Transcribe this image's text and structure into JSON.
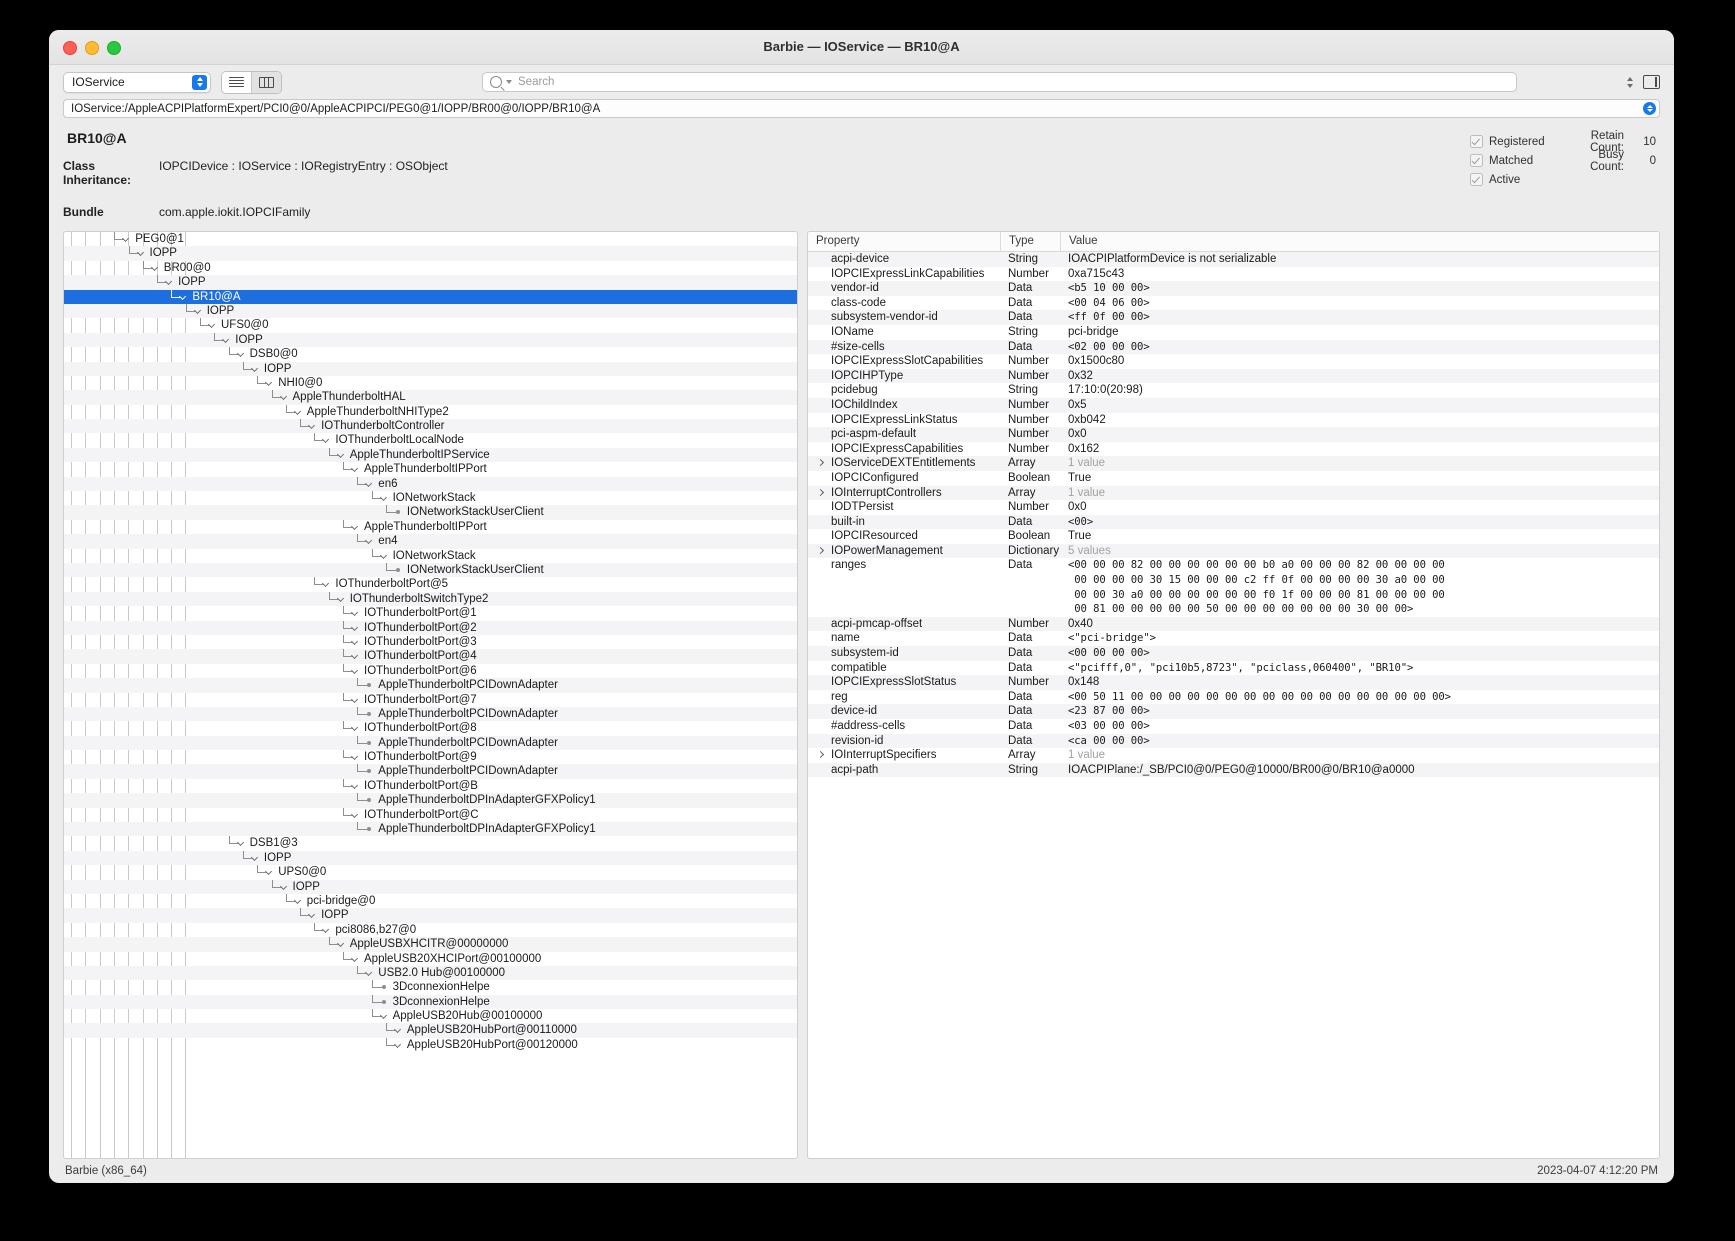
{
  "window": {
    "title": "Barbie — IOService — BR10@A"
  },
  "toolbar": {
    "plane_selector": "IOService",
    "view_list_icon": "list-view-icon",
    "view_column_icon": "column-view-icon",
    "search_placeholder": "Search",
    "search_value": "",
    "search_icon": "search-icon",
    "stepper_icon": "stepper-icon",
    "sidebar_icon": "sidebar-toggle-icon"
  },
  "path_bar": {
    "value": "IOService:/AppleACPIPlatformExpert/PCI0@0/AppleACPIPCI/PEG0@1/IOPP/BR00@0/IOPP/BR10@A"
  },
  "details": {
    "device_title": "BR10@A",
    "class_inheritance_label": "Class Inheritance:",
    "class_inheritance_value": "IOPCIDevice : IOService : IORegistryEntry : OSObject",
    "bundle_label": "Bundle",
    "bundle_value": "com.apple.iokit.IOPCIFamily",
    "flags": [
      {
        "label": "Registered",
        "checked": true,
        "count_label": "Retain Count:",
        "count_value": "10"
      },
      {
        "label": "Matched",
        "checked": true,
        "count_label": "Busy Count:",
        "count_value": "0"
      },
      {
        "label": "Active",
        "checked": true,
        "count_label": "",
        "count_value": ""
      }
    ]
  },
  "tree": {
    "nodes": [
      {
        "depth": 4,
        "label": "PEG0@1",
        "kind": "chevron",
        "selected": false
      },
      {
        "depth": 5,
        "label": "IOPP",
        "kind": "chevron",
        "selected": false
      },
      {
        "depth": 6,
        "label": "BR00@0",
        "kind": "chevron",
        "selected": false
      },
      {
        "depth": 7,
        "label": "IOPP",
        "kind": "chevron",
        "selected": false
      },
      {
        "depth": 8,
        "label": "BR10@A",
        "kind": "chevron",
        "selected": true
      },
      {
        "depth": 9,
        "label": "IOPP",
        "kind": "chevron",
        "selected": false
      },
      {
        "depth": 10,
        "label": "UFS0@0",
        "kind": "chevron",
        "selected": false
      },
      {
        "depth": 11,
        "label": "IOPP",
        "kind": "chevron",
        "selected": false
      },
      {
        "depth": 12,
        "label": "DSB0@0",
        "kind": "chevron",
        "selected": false
      },
      {
        "depth": 13,
        "label": "IOPP",
        "kind": "chevron",
        "selected": false
      },
      {
        "depth": 14,
        "label": "NHI0@0",
        "kind": "chevron",
        "selected": false
      },
      {
        "depth": 15,
        "label": "AppleThunderboltHAL",
        "kind": "chevron",
        "selected": false
      },
      {
        "depth": 16,
        "label": "AppleThunderboltNHIType2",
        "kind": "chevron",
        "selected": false
      },
      {
        "depth": 17,
        "label": "IOThunderboltController",
        "kind": "chevron",
        "selected": false
      },
      {
        "depth": 18,
        "label": "IOThunderboltLocalNode",
        "kind": "chevron",
        "selected": false
      },
      {
        "depth": 19,
        "label": "AppleThunderboltIPService",
        "kind": "chevron",
        "selected": false
      },
      {
        "depth": 20,
        "label": "AppleThunderboltIPPort",
        "kind": "chevron",
        "selected": false
      },
      {
        "depth": 21,
        "label": "en6",
        "kind": "chevron",
        "selected": false
      },
      {
        "depth": 22,
        "label": "IONetworkStack",
        "kind": "chevron",
        "selected": false
      },
      {
        "depth": 23,
        "label": "IONetworkStackUserClient",
        "kind": "dot",
        "selected": false
      },
      {
        "depth": 20,
        "label": "AppleThunderboltIPPort",
        "kind": "chevron",
        "selected": false
      },
      {
        "depth": 21,
        "label": "en4",
        "kind": "chevron",
        "selected": false
      },
      {
        "depth": 22,
        "label": "IONetworkStack",
        "kind": "chevron",
        "selected": false
      },
      {
        "depth": 23,
        "label": "IONetworkStackUserClient",
        "kind": "dot",
        "selected": false
      },
      {
        "depth": 18,
        "label": "IOThunderboltPort@5",
        "kind": "chevron",
        "selected": false
      },
      {
        "depth": 19,
        "label": "IOThunderboltSwitchType2",
        "kind": "chevron",
        "selected": false
      },
      {
        "depth": 20,
        "label": "IOThunderboltPort@1",
        "kind": "chevron",
        "selected": false
      },
      {
        "depth": 20,
        "label": "IOThunderboltPort@2",
        "kind": "chevron",
        "selected": false
      },
      {
        "depth": 20,
        "label": "IOThunderboltPort@3",
        "kind": "chevron",
        "selected": false
      },
      {
        "depth": 20,
        "label": "IOThunderboltPort@4",
        "kind": "chevron",
        "selected": false
      },
      {
        "depth": 20,
        "label": "IOThunderboltPort@6",
        "kind": "chevron",
        "selected": false
      },
      {
        "depth": 21,
        "label": "AppleThunderboltPCIDownAdapter",
        "kind": "dot",
        "selected": false
      },
      {
        "depth": 20,
        "label": "IOThunderboltPort@7",
        "kind": "chevron",
        "selected": false
      },
      {
        "depth": 21,
        "label": "AppleThunderboltPCIDownAdapter",
        "kind": "dot",
        "selected": false
      },
      {
        "depth": 20,
        "label": "IOThunderboltPort@8",
        "kind": "chevron",
        "selected": false
      },
      {
        "depth": 21,
        "label": "AppleThunderboltPCIDownAdapter",
        "kind": "dot",
        "selected": false
      },
      {
        "depth": 20,
        "label": "IOThunderboltPort@9",
        "kind": "chevron",
        "selected": false
      },
      {
        "depth": 21,
        "label": "AppleThunderboltPCIDownAdapter",
        "kind": "dot",
        "selected": false
      },
      {
        "depth": 20,
        "label": "IOThunderboltPort@B",
        "kind": "chevron",
        "selected": false
      },
      {
        "depth": 21,
        "label": "AppleThunderboltDPInAdapterGFXPolicy1",
        "kind": "dot",
        "selected": false
      },
      {
        "depth": 20,
        "label": "IOThunderboltPort@C",
        "kind": "chevron",
        "selected": false
      },
      {
        "depth": 21,
        "label": "AppleThunderboltDPInAdapterGFXPolicy1",
        "kind": "dot",
        "selected": false
      },
      {
        "depth": 12,
        "label": "DSB1@3",
        "kind": "chevron",
        "selected": false
      },
      {
        "depth": 13,
        "label": "IOPP",
        "kind": "chevron",
        "selected": false
      },
      {
        "depth": 14,
        "label": "UPS0@0",
        "kind": "chevron",
        "selected": false
      },
      {
        "depth": 15,
        "label": "IOPP",
        "kind": "chevron",
        "selected": false
      },
      {
        "depth": 16,
        "label": "pci-bridge@0",
        "kind": "chevron",
        "selected": false
      },
      {
        "depth": 17,
        "label": "IOPP",
        "kind": "chevron",
        "selected": false
      },
      {
        "depth": 18,
        "label": "pci8086,b27@0",
        "kind": "chevron",
        "selected": false
      },
      {
        "depth": 19,
        "label": "AppleUSBXHCITR@00000000",
        "kind": "chevron",
        "selected": false
      },
      {
        "depth": 20,
        "label": "AppleUSB20XHCIPort@00100000",
        "kind": "chevron",
        "selected": false
      },
      {
        "depth": 21,
        "label": "USB2.0 Hub@00100000",
        "kind": "chevron",
        "selected": false
      },
      {
        "depth": 22,
        "label": "3DconnexionHelpe",
        "kind": "dot",
        "selected": false
      },
      {
        "depth": 22,
        "label": "3DconnexionHelpe",
        "kind": "dot",
        "selected": false
      },
      {
        "depth": 22,
        "label": "AppleUSB20Hub@00100000",
        "kind": "chevron",
        "selected": false
      },
      {
        "depth": 23,
        "label": "AppleUSB20HubPort@00110000",
        "kind": "chevron",
        "selected": false
      },
      {
        "depth": 23,
        "label": "AppleUSB20HubPort@00120000",
        "kind": "chevron",
        "selected": false
      }
    ]
  },
  "properties": {
    "headers": {
      "property": "Property",
      "type": "Type",
      "value": "Value"
    },
    "rows": [
      {
        "name": "acpi-device",
        "type": "String",
        "value": "IOACPIPlatformDevice is not serializable",
        "style": "plain",
        "expandable": false
      },
      {
        "name": "IOPCIExpressLinkCapabilities",
        "type": "Number",
        "value": "0xa715c43",
        "style": "plain",
        "expandable": false
      },
      {
        "name": "vendor-id",
        "type": "Data",
        "value": "<b5 10 00 00>",
        "style": "mono",
        "expandable": false
      },
      {
        "name": "class-code",
        "type": "Data",
        "value": "<00 04 06 00>",
        "style": "mono",
        "expandable": false
      },
      {
        "name": "subsystem-vendor-id",
        "type": "Data",
        "value": "<ff 0f 00 00>",
        "style": "mono",
        "expandable": false
      },
      {
        "name": "IOName",
        "type": "String",
        "value": "pci-bridge",
        "style": "plain",
        "expandable": false
      },
      {
        "name": "#size-cells",
        "type": "Data",
        "value": "<02 00 00 00>",
        "style": "mono",
        "expandable": false
      },
      {
        "name": "IOPCIExpressSlotCapabilities",
        "type": "Number",
        "value": "0x1500c80",
        "style": "plain",
        "expandable": false
      },
      {
        "name": "IOPCIHPType",
        "type": "Number",
        "value": "0x32",
        "style": "plain",
        "expandable": false
      },
      {
        "name": "pcidebug",
        "type": "String",
        "value": "17:10:0(20:98)",
        "style": "plain",
        "expandable": false
      },
      {
        "name": "IOChildIndex",
        "type": "Number",
        "value": "0x5",
        "style": "plain",
        "expandable": false
      },
      {
        "name": "IOPCIExpressLinkStatus",
        "type": "Number",
        "value": "0xb042",
        "style": "plain",
        "expandable": false
      },
      {
        "name": "pci-aspm-default",
        "type": "Number",
        "value": "0x0",
        "style": "plain",
        "expandable": false
      },
      {
        "name": "IOPCIExpressCapabilities",
        "type": "Number",
        "value": "0x162",
        "style": "plain",
        "expandable": false
      },
      {
        "name": "IOServiceDEXTEntitlements",
        "type": "Array",
        "value": "1 value",
        "style": "dim",
        "expandable": true
      },
      {
        "name": "IOPCIConfigured",
        "type": "Boolean",
        "value": "True",
        "style": "plain",
        "expandable": false
      },
      {
        "name": "IOInterruptControllers",
        "type": "Array",
        "value": "1 value",
        "style": "dim",
        "expandable": true
      },
      {
        "name": "IODTPersist",
        "type": "Number",
        "value": "0x0",
        "style": "plain",
        "expandable": false
      },
      {
        "name": "built-in",
        "type": "Data",
        "value": "<00>",
        "style": "mono",
        "expandable": false
      },
      {
        "name": "IOPCIResourced",
        "type": "Boolean",
        "value": "True",
        "style": "plain",
        "expandable": false
      },
      {
        "name": "IOPowerManagement",
        "type": "Dictionary",
        "value": "5 values",
        "style": "dim",
        "expandable": true
      },
      {
        "name": "ranges",
        "type": "Data",
        "value": "<00 00 00 82 00 00 00 00 00 00 b0 a0 00 00 00 82 00 00 00 00\n 00 00 00 00 30 15 00 00 00 c2 ff 0f 00 00 00 00 30 a0 00 00\n 00 00 30 a0 00 00 00 00 00 00 f0 1f 00 00 00 81 00 00 00 00\n 00 81 00 00 00 00 00 50 00 00 00 00 00 00 00 30 00 00>",
        "style": "mono",
        "expandable": false
      },
      {
        "name": "acpi-pmcap-offset",
        "type": "Number",
        "value": "0x40",
        "style": "plain",
        "expandable": false
      },
      {
        "name": "name",
        "type": "Data",
        "value": "<\"pci-bridge\">",
        "style": "mono",
        "expandable": false
      },
      {
        "name": "subsystem-id",
        "type": "Data",
        "value": "<00 00 00 00>",
        "style": "mono",
        "expandable": false
      },
      {
        "name": "compatible",
        "type": "Data",
        "value": "<\"pcifff,0\", \"pci10b5,8723\", \"pciclass,060400\", \"BR10\">",
        "style": "mono",
        "expandable": false
      },
      {
        "name": "IOPCIExpressSlotStatus",
        "type": "Number",
        "value": "0x148",
        "style": "plain",
        "expandable": false
      },
      {
        "name": "reg",
        "type": "Data",
        "value": "<00 50 11 00 00 00 00 00 00 00 00 00 00 00 00 00 00 00 00 00>",
        "style": "mono",
        "expandable": false
      },
      {
        "name": "device-id",
        "type": "Data",
        "value": "<23 87 00 00>",
        "style": "mono",
        "expandable": false
      },
      {
        "name": "#address-cells",
        "type": "Data",
        "value": "<03 00 00 00>",
        "style": "mono",
        "expandable": false
      },
      {
        "name": "revision-id",
        "type": "Data",
        "value": "<ca 00 00 00>",
        "style": "mono",
        "expandable": false
      },
      {
        "name": "IOInterruptSpecifiers",
        "type": "Array",
        "value": "1 value",
        "style": "dim",
        "expandable": true
      },
      {
        "name": "acpi-path",
        "type": "String",
        "value": "IOACPIPlane:/_SB/PCI0@0/PEG0@10000/BR00@0/BR10@a0000",
        "style": "plain",
        "expandable": false
      }
    ]
  },
  "status_bar": {
    "left": "Barbie (x86_64)",
    "right": "2023-04-07 4:12:20 PM"
  },
  "colors": {
    "selection": "#1d6fe0",
    "accent": "#1879ec",
    "alt_row": "#f4f4f6"
  }
}
